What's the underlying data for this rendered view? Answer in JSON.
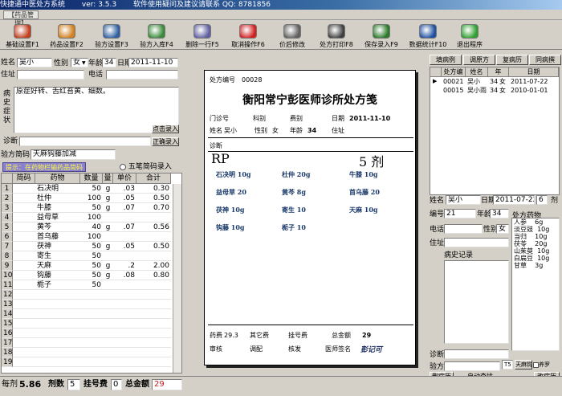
{
  "window": {
    "title_parts": [
      "快捷通中医处方系统",
      "ver: 3.5.3",
      "软件使用疑问及建议请联系 QQ: 8781856"
    ],
    "subtitle": "【药品管理】"
  },
  "toolbar": [
    {
      "label": "基础设置F1",
      "icon": "settings-icon",
      "color": "#c04020"
    },
    {
      "label": "药品设置F2",
      "icon": "herb-icon",
      "color": "#d08020"
    },
    {
      "label": "验方设置F3",
      "icon": "book-icon",
      "color": "#3060a0"
    },
    {
      "label": "验方入库F4",
      "icon": "import-icon",
      "color": "#3a8a3a"
    },
    {
      "label": "删除一行F5",
      "icon": "delete-row-icon",
      "color": "#6060a0"
    },
    {
      "label": "取消操作F6",
      "icon": "cancel-icon",
      "color": "#d02020"
    },
    {
      "label": "价后修改",
      "icon": "tools-icon",
      "color": "#606060"
    },
    {
      "label": "处方打印F8",
      "icon": "printer-icon",
      "color": "#404040"
    },
    {
      "label": "保存录入F9",
      "icon": "save-icon",
      "color": "#2a7a2a"
    },
    {
      "label": "数据统计F10",
      "icon": "chart-icon",
      "color": "#2050a0"
    },
    {
      "label": "退出程序",
      "icon": "exit-icon",
      "color": "#30a030"
    }
  ],
  "patient": {
    "name_label": "姓名",
    "name": "吴小",
    "sex_label": "性别",
    "sex": "女",
    "age_label": "年龄",
    "age": "34",
    "date_label": "日期",
    "date": "2011-11-10",
    "address_label": "住址",
    "address": "",
    "phone_label": "电话",
    "phone": ""
  },
  "history": {
    "label": "病史症状",
    "text": "原症好转、舌红苔黄、细数。",
    "btn_click": "点击录入",
    "diagnosis_label": "诊断",
    "diagnosis": "",
    "btn_confirm": "正确录入"
  },
  "prescription_info": {
    "name_label": "验方简码",
    "name_value": "天麻钩藤加减",
    "hint": "提示：在药物栏输药品简码",
    "five_stroke_label": "五笔简码录入"
  },
  "grid": {
    "headers": [
      "简码",
      "药物",
      "数量",
      "量",
      "单价",
      "合计"
    ],
    "rows": [
      {
        "no": "1",
        "drug": "石决明",
        "qty": "50",
        "unit": "g",
        "price": ".03",
        "total": "0.30"
      },
      {
        "no": "2",
        "drug": "杜仲",
        "qty": "100",
        "unit": "g",
        "price": ".05",
        "total": "0.50"
      },
      {
        "no": "3",
        "drug": "牛膝",
        "qty": "50",
        "unit": "g",
        "price": ".07",
        "total": "0.70"
      },
      {
        "no": "4",
        "drug": "益母草",
        "qty": "100",
        "unit": "",
        "price": "",
        "total": ""
      },
      {
        "no": "5",
        "drug": "黄芩",
        "qty": "40",
        "unit": "g",
        "price": ".07",
        "total": "0.56"
      },
      {
        "no": "6",
        "drug": "首乌藤",
        "qty": "100",
        "unit": "",
        "price": "",
        "total": ""
      },
      {
        "no": "7",
        "drug": "茯神",
        "qty": "50",
        "unit": "g",
        "price": ".05",
        "total": "0.50"
      },
      {
        "no": "8",
        "drug": "寄生",
        "qty": "50",
        "unit": "",
        "price": "",
        "total": ""
      },
      {
        "no": "9",
        "drug": "天麻",
        "qty": "50",
        "unit": "g",
        "price": ".2",
        "total": "2.00"
      },
      {
        "no": "10",
        "drug": "钩藤",
        "qty": "50",
        "unit": "g",
        "price": ".08",
        "total": "0.80"
      },
      {
        "no": "11",
        "drug": "栀子",
        "qty": "50",
        "unit": "",
        "price": "",
        "total": ""
      },
      {
        "no": "12",
        "drug": "",
        "qty": "",
        "unit": "",
        "price": "",
        "total": ""
      },
      {
        "no": "13",
        "drug": "",
        "qty": "",
        "unit": "",
        "price": "",
        "total": ""
      },
      {
        "no": "14",
        "drug": "",
        "qty": "",
        "unit": "",
        "price": "",
        "total": ""
      },
      {
        "no": "15",
        "drug": "",
        "qty": "",
        "unit": "",
        "price": "",
        "total": ""
      },
      {
        "no": "16",
        "drug": "",
        "qty": "",
        "unit": "",
        "price": "",
        "total": ""
      },
      {
        "no": "17",
        "drug": "",
        "qty": "",
        "unit": "",
        "price": "",
        "total": ""
      },
      {
        "no": "18",
        "drug": "",
        "qty": "",
        "unit": "",
        "price": "",
        "total": ""
      },
      {
        "no": "19",
        "drug": "",
        "qty": "",
        "unit": "",
        "price": "",
        "total": ""
      }
    ]
  },
  "totals": {
    "per_dose_label": "每剂",
    "per_dose": "5.86",
    "doses_label": "剂数",
    "doses": "5",
    "reg_label": "挂号费",
    "reg": "0",
    "total_label": "总金额",
    "total": "29"
  },
  "paper": {
    "no_label": "处方编号",
    "no": "00028",
    "title": "衡阳常宁彭医师诊所处方笺",
    "clinic_label": "门诊号",
    "dept_label": "科别",
    "fee_label": "费别",
    "date_label": "日期",
    "date": "2011-11-10",
    "name_label": "姓名",
    "name": "吴小",
    "sex_label": "性别",
    "sex": "女",
    "age_label": "年龄",
    "age": "34",
    "addr_label": "住址",
    "diag_label": "诊断",
    "rp": "RP",
    "dose": "5 剂",
    "herbs": [
      "石决明 10g",
      "杜仲 20g",
      "牛膝 10g",
      "益母草 20",
      "黄芩 8g",
      "首乌藤 20",
      "茯神 10g",
      "寄生 10",
      "天麻 10g",
      "钩藤 10g",
      "栀子 10",
      ""
    ],
    "drug_fee_label": "药费",
    "drug_fee": "29.3",
    "other_fee_label": "其它费",
    "reg_fee_label": "挂号费",
    "total_label": "总金额",
    "total": "29",
    "review_label": "审核",
    "dispense_label": "调配",
    "check_label": "核发",
    "doctor_label": "医师签名",
    "doctor": "彭记可"
  },
  "right": {
    "tabs": [
      "填病例",
      "调原方",
      "复病历",
      "同病撰"
    ],
    "grid_headers": [
      "处方编",
      "姓名",
      "年",
      "日期"
    ],
    "grid_rows": [
      {
        "no": "00021",
        "name": "吴小",
        "age": "34",
        "sex": "女",
        "date": "2011-07-22"
      },
      {
        "no": "00015",
        "name": "吴小雨",
        "age": "34",
        "sex": "女",
        "date": "2010-01-01"
      }
    ],
    "name_label": "姓名",
    "name": "吴小",
    "date_label": "日期",
    "date": "2011-07-22",
    "dose_value": "6",
    "dose_unit": "剂",
    "no_label": "编号",
    "no": "21",
    "age_label": "年龄",
    "age": "34",
    "phone_label": "电话",
    "sex_label": "性别",
    "sex": "女",
    "addr_label": "住址",
    "drugs_label": "处方药物",
    "drugs": [
      "人参    6g",
      "淡豆豉  10g",
      "当归    10g",
      "茯苓    20g",
      "山茱萸  10g",
      "白扁豆  10g",
      "甘草    3g"
    ],
    "records_label": "病史记录",
    "diagnosis_label": "诊断",
    "rx_label": "验方",
    "rx_value": "T5",
    "rx_btn": "天麻钩",
    "rx_chk": "养罗",
    "btn_delete": "删病历",
    "btn_search": "自动查找",
    "search_value": "姓名",
    "btn_edit": "改病历"
  }
}
